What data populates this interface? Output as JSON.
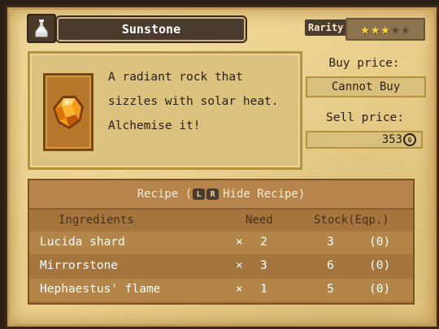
{
  "item": {
    "name": "Sunstone",
    "icon": "sunstone-gem-icon",
    "slot_icon": "potion-flask-icon",
    "description": "A radiant rock that\nsizzles with solar heat.\nAlchemise it!"
  },
  "rarity": {
    "label": "Rarity",
    "stars_filled": 3,
    "stars_total": 5
  },
  "prices": {
    "buy_label": "Buy price:",
    "buy_value": "Cannot Buy",
    "sell_label": "Sell price:",
    "sell_value": "353",
    "currency_icon": "gold-coin-icon",
    "currency_glyph": "G"
  },
  "recipe": {
    "title": "Recipe (",
    "button_l": "L",
    "button_r": "R",
    "hide_label": "Hide Recipe)",
    "columns": {
      "ingredients": "Ingredients",
      "need": "Need",
      "stock": "Stock(Eqp.)"
    },
    "rows": [
      {
        "name": "Lucida shard",
        "times": "×",
        "need": "2",
        "stock": "3",
        "equipped": "(0)"
      },
      {
        "name": "Mirrorstone",
        "times": "×",
        "need": "3",
        "stock": "6",
        "equipped": "(0)"
      },
      {
        "name": "Hephaestus' flame",
        "times": "×",
        "need": "1",
        "stock": "5",
        "equipped": "(0)"
      }
    ]
  },
  "colors": {
    "parchment": "#e9cf8b",
    "recipe_panel": "#a4763e",
    "star_filled": "#f7d440",
    "gem": "#f39a1c"
  }
}
